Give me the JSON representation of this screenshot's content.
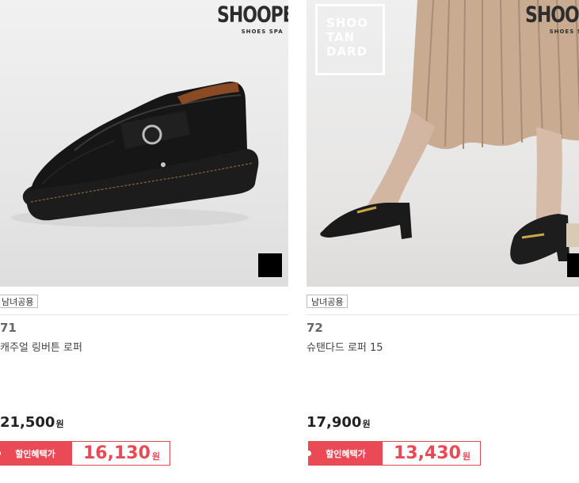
{
  "products": [
    {
      "brand_logo": "SHOOPEN",
      "brand_sub": "SHOES SPA",
      "tag": "남녀공용",
      "rank": "71",
      "name": "캐주얼 링버튼 로퍼",
      "price": "21,500",
      "currency": "원",
      "sale_label": "할인혜택가",
      "sale_price": "16,130",
      "swatch_color": "#000000"
    },
    {
      "brand_logo": "SHOOPEN",
      "brand_sub": "SHOES SPA",
      "sub_brand_lines": [
        "SHOO",
        "TAN",
        "DARD"
      ],
      "tag": "남녀공용",
      "rank": "72",
      "name": "슈탠다드 로퍼 15",
      "price": "17,900",
      "currency": "원",
      "sale_label": "할인혜택가",
      "sale_price": "13,430",
      "swatch_color": "#000000"
    }
  ]
}
